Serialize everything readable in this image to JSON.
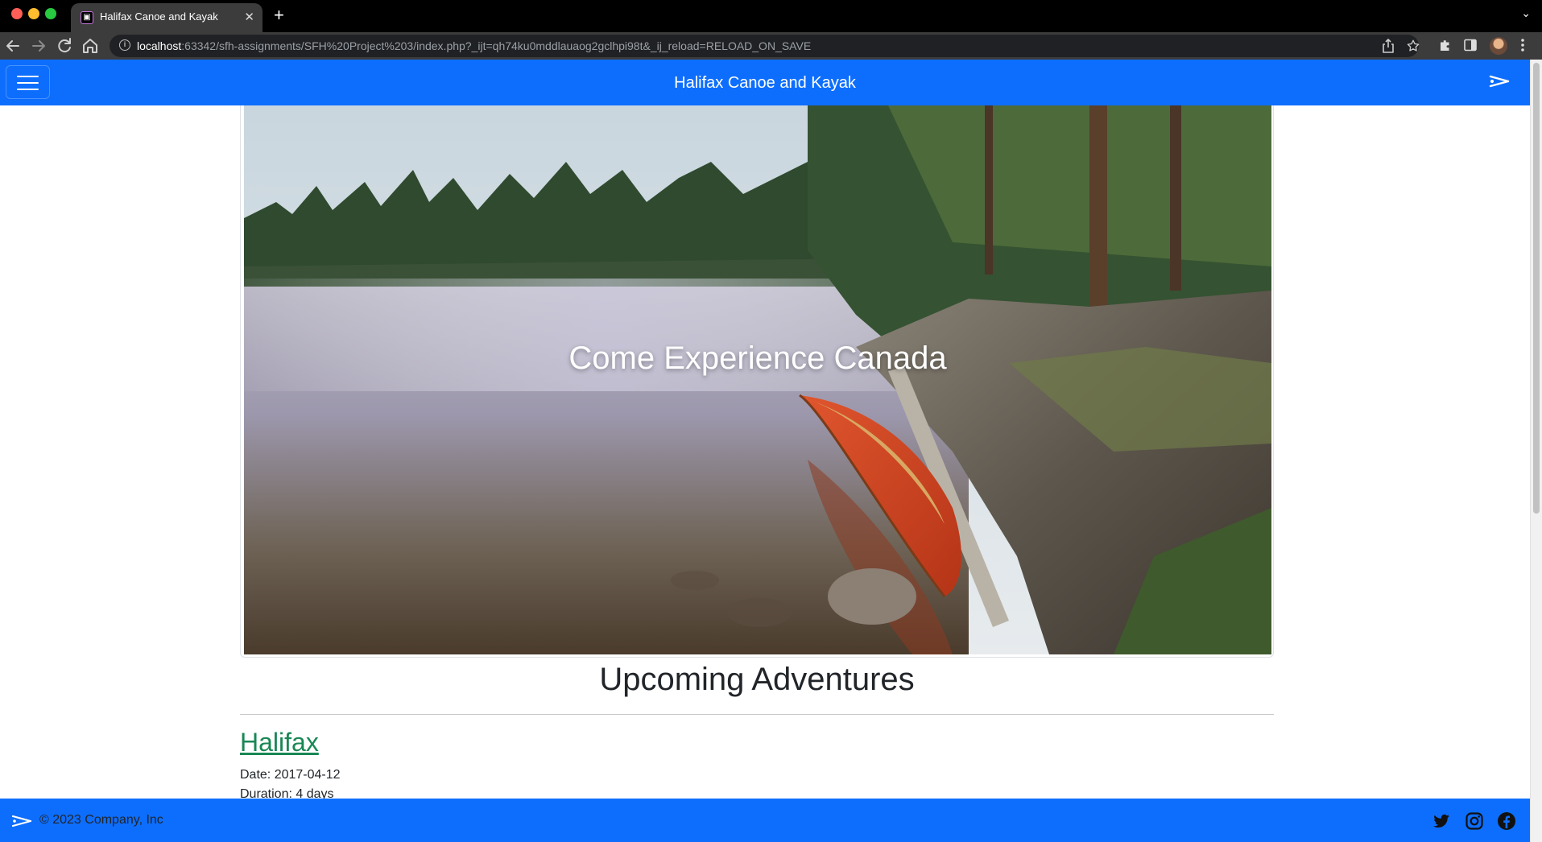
{
  "browser": {
    "tab_title": "Halifax Canoe and Kayak",
    "tab_close": "✕",
    "new_tab": "+",
    "tab_menu": "⌄",
    "url_host": "localhost",
    "url_rest": ":63342/sfh-assignments/SFH%20Project%203/index.php?_ijt=qh74ku0mddlauaog2gclhpi98t&_ij_reload=RELOAD_ON_SAVE",
    "nav_icons": [
      "back-icon",
      "forward-icon",
      "reload-icon",
      "home-icon"
    ],
    "toolbar_icons": [
      "share-icon",
      "bookmark-star-icon",
      "extensions-icon",
      "sidepanel-icon",
      "profile-avatar",
      "menu-kebab-icon"
    ]
  },
  "navbar": {
    "title": "Halifax Canoe and Kayak",
    "menu_icon": "hamburger-icon",
    "logo_icon": "bootstrap-brand-icon",
    "bg_color": "#0d6efd"
  },
  "hero": {
    "heading": "Come Experience Canada",
    "image": "canoe-lake-photo"
  },
  "main": {
    "section_title": "Upcoming Adventures",
    "adventures": [
      {
        "name": "Halifax",
        "date": "Date: 2017-04-12",
        "duration": "Duration: 4 days"
      }
    ],
    "link_color": "#198754"
  },
  "footer": {
    "copyright": "© 2023 Company, Inc",
    "social_icons": [
      "twitter-icon",
      "instagram-icon",
      "facebook-icon"
    ]
  }
}
